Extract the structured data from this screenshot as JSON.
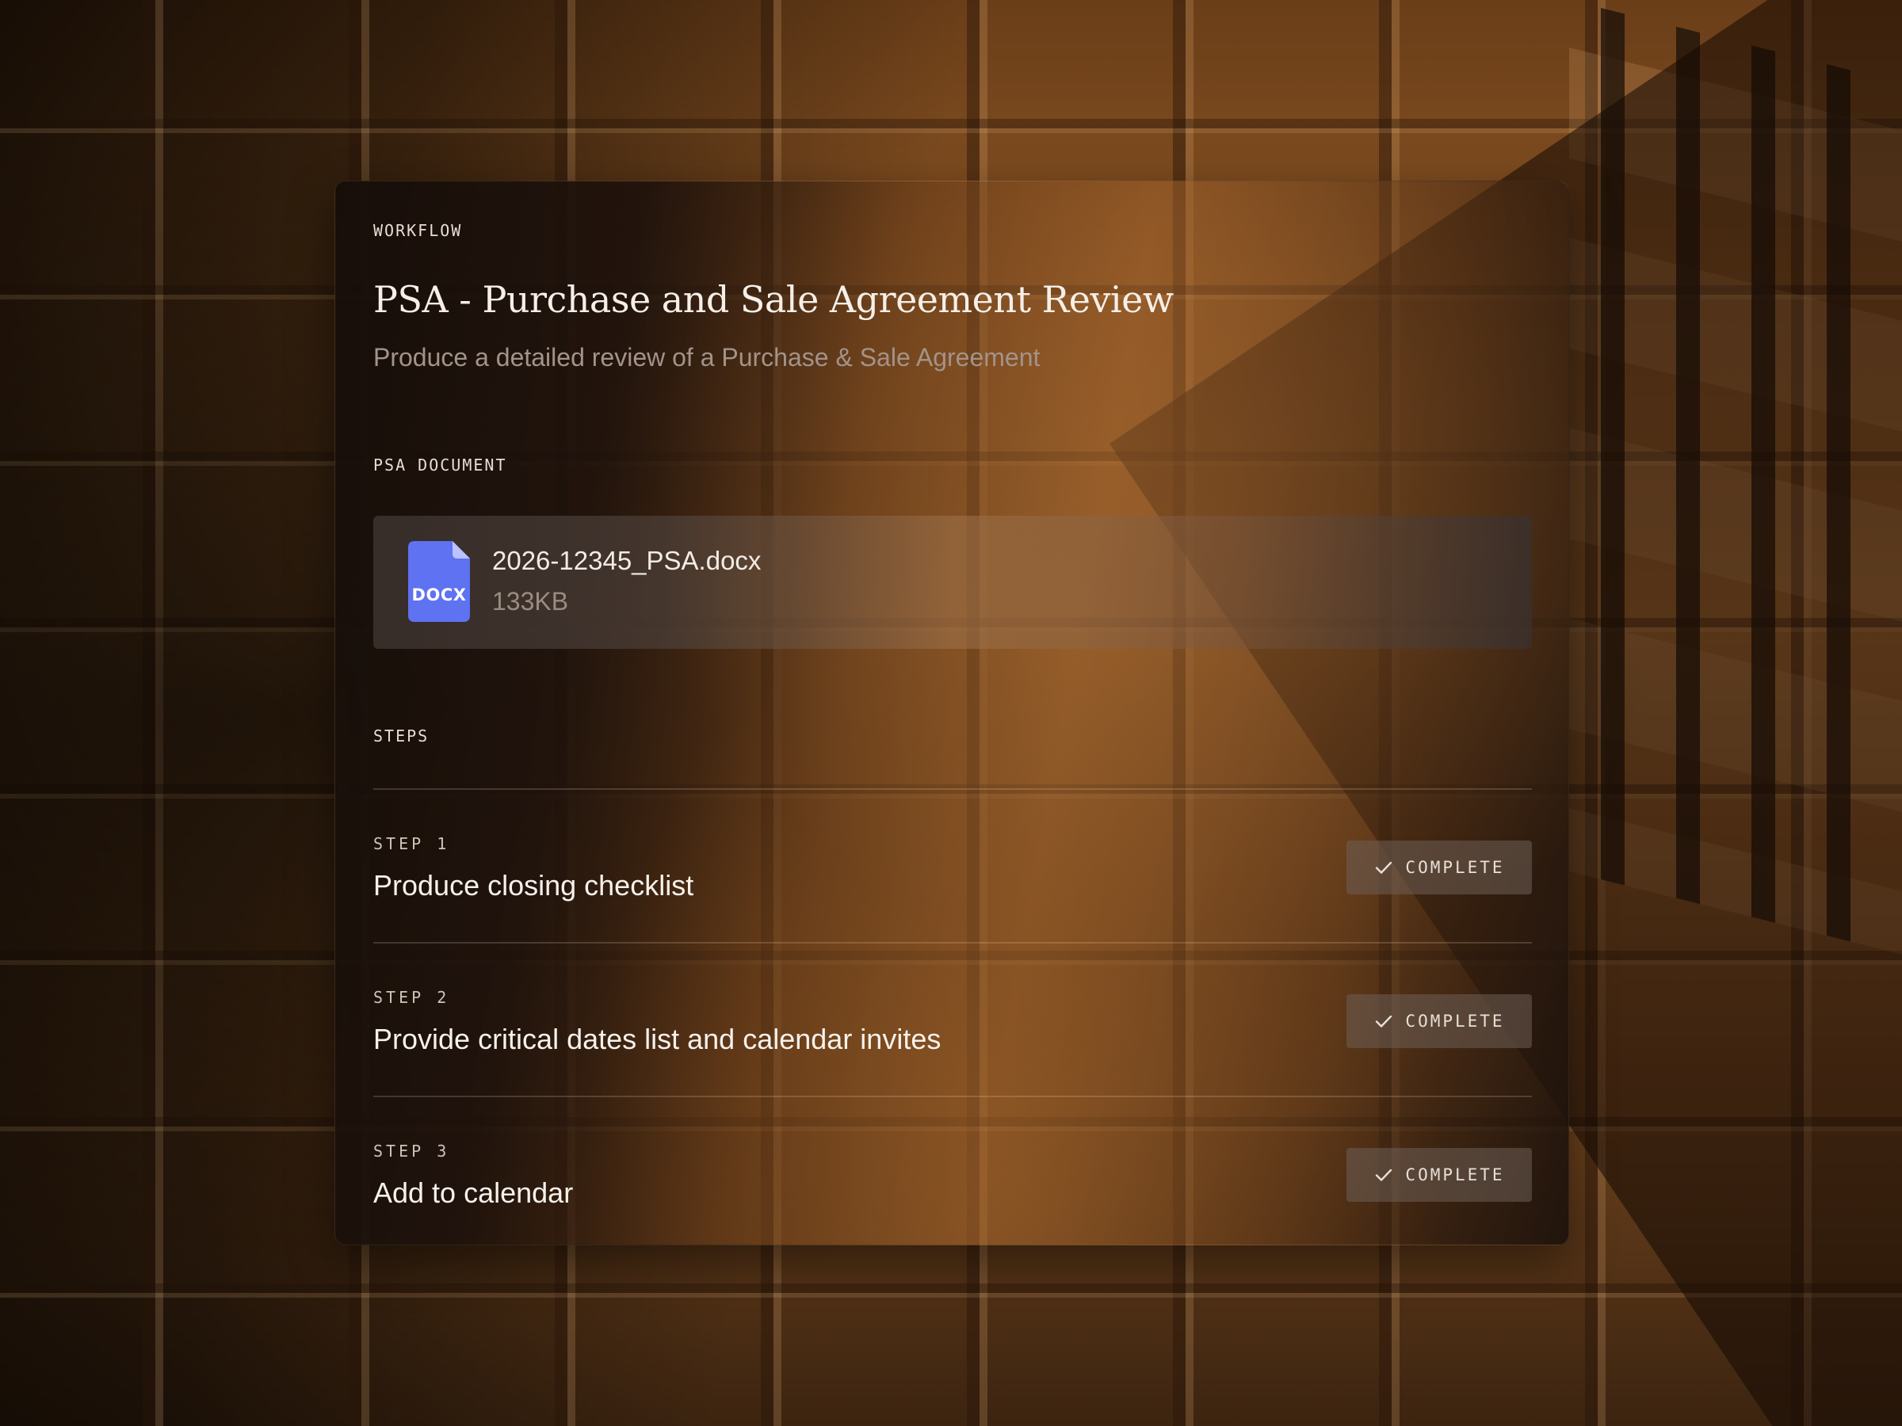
{
  "workflow": {
    "eyebrow": "WORKFLOW",
    "title": "PSA - Purchase and Sale Agreement Review",
    "subtitle": "Produce a detailed review of a Purchase & Sale Agreement"
  },
  "document": {
    "section_label": "PSA DOCUMENT",
    "icon": "docx-file-icon",
    "icon_label": "DOCX",
    "icon_color": "#5e72f2",
    "file_name": "2026-12345_PSA.docx",
    "file_size": "133KB"
  },
  "steps": {
    "section_label": "STEPS",
    "items": [
      {
        "number_label": "STEP 1",
        "title": "Produce closing checklist",
        "status": "COMPLETE",
        "status_icon": "check-icon"
      },
      {
        "number_label": "STEP 2",
        "title": "Provide critical dates list and calendar invites",
        "status": "COMPLETE",
        "status_icon": "check-icon"
      },
      {
        "number_label": "STEP 3",
        "title": "Add to calendar",
        "status": "COMPLETE",
        "status_icon": "check-icon"
      }
    ]
  }
}
